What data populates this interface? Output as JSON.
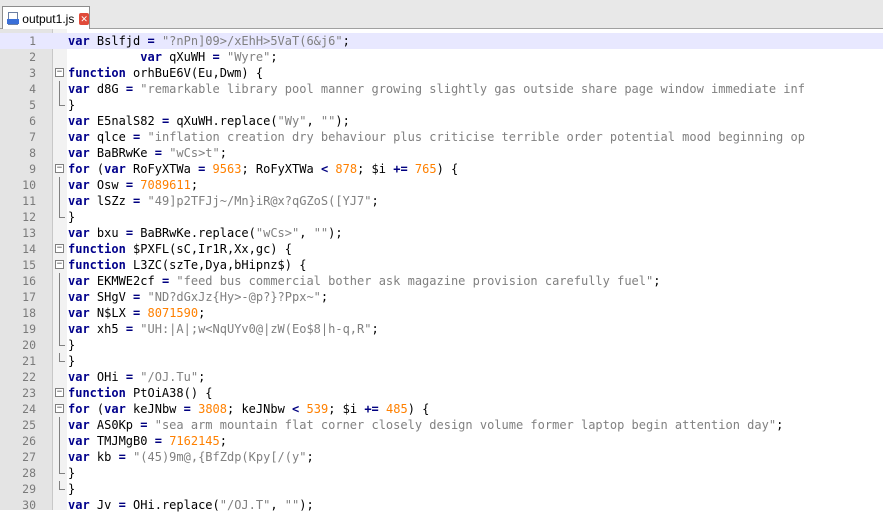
{
  "tab": {
    "title": "output1.js",
    "close_glyph": "✕",
    "icon": "js-file-icon"
  },
  "lines": [
    {
      "n": "1",
      "fold": "none",
      "current": true,
      "t": [
        [
          "kw",
          "var"
        ],
        [
          "p",
          " Bslfjd "
        ],
        [
          "op",
          "="
        ],
        [
          "p",
          " "
        ],
        [
          "str",
          "\"?nPn]09>/xEhH>5VaT(6&j6\""
        ],
        [
          "p",
          ";"
        ]
      ]
    },
    {
      "n": "2",
      "fold": "none",
      "t": [
        [
          "p",
          "          "
        ],
        [
          "kw",
          "var"
        ],
        [
          "p",
          " qXuWH "
        ],
        [
          "op",
          "="
        ],
        [
          "p",
          " "
        ],
        [
          "str",
          "\"Wyre\""
        ],
        [
          "p",
          ";"
        ]
      ]
    },
    {
      "n": "3",
      "fold": "open",
      "t": [
        [
          "kw",
          "function"
        ],
        [
          "p",
          " orhBuE6V(Eu,Dwm) {"
        ]
      ]
    },
    {
      "n": "4",
      "fold": "line",
      "t": [
        [
          "kw",
          "var"
        ],
        [
          "p",
          " d8G "
        ],
        [
          "op",
          "="
        ],
        [
          "p",
          " "
        ],
        [
          "str",
          "\"remarkable library pool manner growing slightly gas outside share page window immediate inf"
        ]
      ]
    },
    {
      "n": "5",
      "fold": "end",
      "t": [
        [
          "p",
          "}"
        ]
      ]
    },
    {
      "n": "6",
      "fold": "none",
      "t": [
        [
          "kw",
          "var"
        ],
        [
          "p",
          " E5nalS82 "
        ],
        [
          "op",
          "="
        ],
        [
          "p",
          " qXuWH.replace("
        ],
        [
          "str",
          "\"Wy\""
        ],
        [
          "p",
          ", "
        ],
        [
          "str",
          "\"\""
        ],
        [
          "p",
          ");"
        ]
      ]
    },
    {
      "n": "7",
      "fold": "none",
      "t": [
        [
          "kw",
          "var"
        ],
        [
          "p",
          " qlce "
        ],
        [
          "op",
          "="
        ],
        [
          "p",
          " "
        ],
        [
          "str",
          "\"inflation creation dry behaviour plus criticise terrible order potential mood beginning op"
        ]
      ]
    },
    {
      "n": "8",
      "fold": "none",
      "t": [
        [
          "kw",
          "var"
        ],
        [
          "p",
          " BaBRwKe "
        ],
        [
          "op",
          "="
        ],
        [
          "p",
          " "
        ],
        [
          "str",
          "\"wCs>t\""
        ],
        [
          "p",
          ";"
        ]
      ]
    },
    {
      "n": "9",
      "fold": "open",
      "t": [
        [
          "kw",
          "for"
        ],
        [
          "p",
          " ("
        ],
        [
          "kw",
          "var"
        ],
        [
          "p",
          " RoFyXTWa "
        ],
        [
          "op",
          "="
        ],
        [
          "p",
          " "
        ],
        [
          "num",
          "9563"
        ],
        [
          "p",
          "; RoFyXTWa "
        ],
        [
          "op",
          "<"
        ],
        [
          "p",
          " "
        ],
        [
          "num",
          "878"
        ],
        [
          "p",
          "; $i "
        ],
        [
          "op",
          "+="
        ],
        [
          "p",
          " "
        ],
        [
          "num",
          "765"
        ],
        [
          "p",
          ") {"
        ]
      ]
    },
    {
      "n": "10",
      "fold": "line",
      "t": [
        [
          "kw",
          "var"
        ],
        [
          "p",
          " Osw "
        ],
        [
          "op",
          "="
        ],
        [
          "p",
          " "
        ],
        [
          "num",
          "7089611"
        ],
        [
          "p",
          ";"
        ]
      ]
    },
    {
      "n": "11",
      "fold": "line",
      "t": [
        [
          "kw",
          "var"
        ],
        [
          "p",
          " lSZz "
        ],
        [
          "op",
          "="
        ],
        [
          "p",
          " "
        ],
        [
          "str",
          "\"49]p2TFJj~/Mn}iR@x?qGZoS([YJ7\""
        ],
        [
          "p",
          ";"
        ]
      ]
    },
    {
      "n": "12",
      "fold": "end",
      "t": [
        [
          "p",
          "}"
        ]
      ]
    },
    {
      "n": "13",
      "fold": "none",
      "t": [
        [
          "kw",
          "var"
        ],
        [
          "p",
          " bxu "
        ],
        [
          "op",
          "="
        ],
        [
          "p",
          " BaBRwKe.replace("
        ],
        [
          "str",
          "\"wCs>\""
        ],
        [
          "p",
          ", "
        ],
        [
          "str",
          "\"\""
        ],
        [
          "p",
          ");"
        ]
      ]
    },
    {
      "n": "14",
      "fold": "open",
      "t": [
        [
          "kw",
          "function"
        ],
        [
          "p",
          " $PXFL(sC,Ir1R,Xx,gc) {"
        ]
      ]
    },
    {
      "n": "15",
      "fold": "open",
      "t": [
        [
          "kw",
          "function"
        ],
        [
          "p",
          " L3ZC(szTe,Dya,bHipnz$) {"
        ]
      ]
    },
    {
      "n": "16",
      "fold": "line",
      "t": [
        [
          "kw",
          "var"
        ],
        [
          "p",
          " EKMWE2cf "
        ],
        [
          "op",
          "="
        ],
        [
          "p",
          " "
        ],
        [
          "str",
          "\"feed bus commercial bother ask magazine provision carefully fuel\""
        ],
        [
          "p",
          ";"
        ]
      ]
    },
    {
      "n": "17",
      "fold": "line",
      "t": [
        [
          "kw",
          "var"
        ],
        [
          "p",
          " SHgV "
        ],
        [
          "op",
          "="
        ],
        [
          "p",
          " "
        ],
        [
          "str",
          "\"ND?dGxJz{Hy>-@p?}?Ppx~\""
        ],
        [
          "p",
          ";"
        ]
      ]
    },
    {
      "n": "18",
      "fold": "line",
      "t": [
        [
          "kw",
          "var"
        ],
        [
          "p",
          " N$LX "
        ],
        [
          "op",
          "="
        ],
        [
          "p",
          " "
        ],
        [
          "num",
          "8071590"
        ],
        [
          "p",
          ";"
        ]
      ]
    },
    {
      "n": "19",
      "fold": "line",
      "t": [
        [
          "kw",
          "var"
        ],
        [
          "p",
          " xh5 "
        ],
        [
          "op",
          "="
        ],
        [
          "p",
          " "
        ],
        [
          "str",
          "\"UH:|A|;w<NqUYv0@|zW(Eo$8|h-q,R\""
        ],
        [
          "p",
          ";"
        ]
      ]
    },
    {
      "n": "20",
      "fold": "end",
      "t": [
        [
          "p",
          "}"
        ]
      ]
    },
    {
      "n": "21",
      "fold": "end",
      "t": [
        [
          "p",
          "}"
        ]
      ]
    },
    {
      "n": "22",
      "fold": "none",
      "t": [
        [
          "kw",
          "var"
        ],
        [
          "p",
          " OHi "
        ],
        [
          "op",
          "="
        ],
        [
          "p",
          " "
        ],
        [
          "str",
          "\"/OJ.Tu\""
        ],
        [
          "p",
          ";"
        ]
      ]
    },
    {
      "n": "23",
      "fold": "open",
      "t": [
        [
          "kw",
          "function"
        ],
        [
          "p",
          " PtOiA38() {"
        ]
      ]
    },
    {
      "n": "24",
      "fold": "open",
      "t": [
        [
          "kw",
          "for"
        ],
        [
          "p",
          " ("
        ],
        [
          "kw",
          "var"
        ],
        [
          "p",
          " keJNbw "
        ],
        [
          "op",
          "="
        ],
        [
          "p",
          " "
        ],
        [
          "num",
          "3808"
        ],
        [
          "p",
          "; keJNbw "
        ],
        [
          "op",
          "<"
        ],
        [
          "p",
          " "
        ],
        [
          "num",
          "539"
        ],
        [
          "p",
          "; $i "
        ],
        [
          "op",
          "+="
        ],
        [
          "p",
          " "
        ],
        [
          "num",
          "485"
        ],
        [
          "p",
          ") {"
        ]
      ]
    },
    {
      "n": "25",
      "fold": "line",
      "t": [
        [
          "kw",
          "var"
        ],
        [
          "p",
          " AS0Kp "
        ],
        [
          "op",
          "="
        ],
        [
          "p",
          " "
        ],
        [
          "str",
          "\"sea arm mountain flat corner closely design volume former laptop begin attention day\""
        ],
        [
          "p",
          ";"
        ]
      ]
    },
    {
      "n": "26",
      "fold": "line",
      "t": [
        [
          "kw",
          "var"
        ],
        [
          "p",
          " TMJMgB0 "
        ],
        [
          "op",
          "="
        ],
        [
          "p",
          " "
        ],
        [
          "num",
          "7162145"
        ],
        [
          "p",
          ";"
        ]
      ]
    },
    {
      "n": "27",
      "fold": "line",
      "t": [
        [
          "kw",
          "var"
        ],
        [
          "p",
          " kb "
        ],
        [
          "op",
          "="
        ],
        [
          "p",
          " "
        ],
        [
          "str",
          "\"(45)9m@,{BfZdp(Kpy[/(y\""
        ],
        [
          "p",
          ";"
        ]
      ]
    },
    {
      "n": "28",
      "fold": "end",
      "t": [
        [
          "p",
          "}"
        ]
      ]
    },
    {
      "n": "29",
      "fold": "end",
      "t": [
        [
          "p",
          "}"
        ]
      ]
    },
    {
      "n": "30",
      "fold": "none",
      "t": [
        [
          "kw",
          "var"
        ],
        [
          "p",
          " Jv "
        ],
        [
          "op",
          "="
        ],
        [
          "p",
          " OHi.replace("
        ],
        [
          "str",
          "\"/OJ.T\""
        ],
        [
          "p",
          ", "
        ],
        [
          "str",
          "\"\""
        ],
        [
          "p",
          ");"
        ]
      ]
    }
  ]
}
